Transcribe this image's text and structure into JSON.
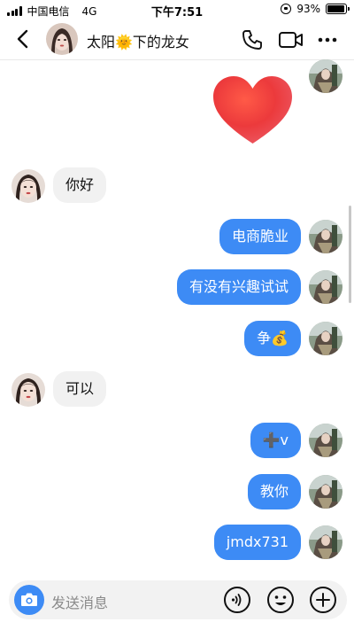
{
  "status_bar": {
    "carrier": "中国电信",
    "network": "4G",
    "time": "下午7:51",
    "battery": "93%",
    "battery_level": 0.93
  },
  "header": {
    "title": "太阳🌞下的龙女",
    "back_icon": "chevron-left-icon",
    "call_icon": "phone-icon",
    "video_icon": "video-camera-icon",
    "more_icon": "more-dots-icon"
  },
  "messages": [
    {
      "direction": "out",
      "type": "sticker",
      "sticker": "red-heart"
    },
    {
      "direction": "in",
      "type": "text",
      "text": "你好"
    },
    {
      "direction": "out",
      "type": "text",
      "text": "电商脆业"
    },
    {
      "direction": "out",
      "type": "text",
      "text": "有没有兴趣试试"
    },
    {
      "direction": "out",
      "type": "text",
      "text": "争💰"
    },
    {
      "direction": "in",
      "type": "text",
      "text": "可以"
    },
    {
      "direction": "out",
      "type": "text",
      "text": "➕v"
    },
    {
      "direction": "out",
      "type": "text",
      "text": "教你"
    },
    {
      "direction": "out",
      "type": "text",
      "text": "jmdx731"
    }
  ],
  "input": {
    "placeholder": "发送消息",
    "camera_icon": "camera-icon",
    "voice_icon": "voice-icon",
    "emoji_icon": "emoji-icon",
    "plus_icon": "plus-icon"
  },
  "colors": {
    "outgoing_bubble": "#3d8bf5",
    "incoming_bubble": "#f1f1f1",
    "heart": "#e8333d"
  }
}
